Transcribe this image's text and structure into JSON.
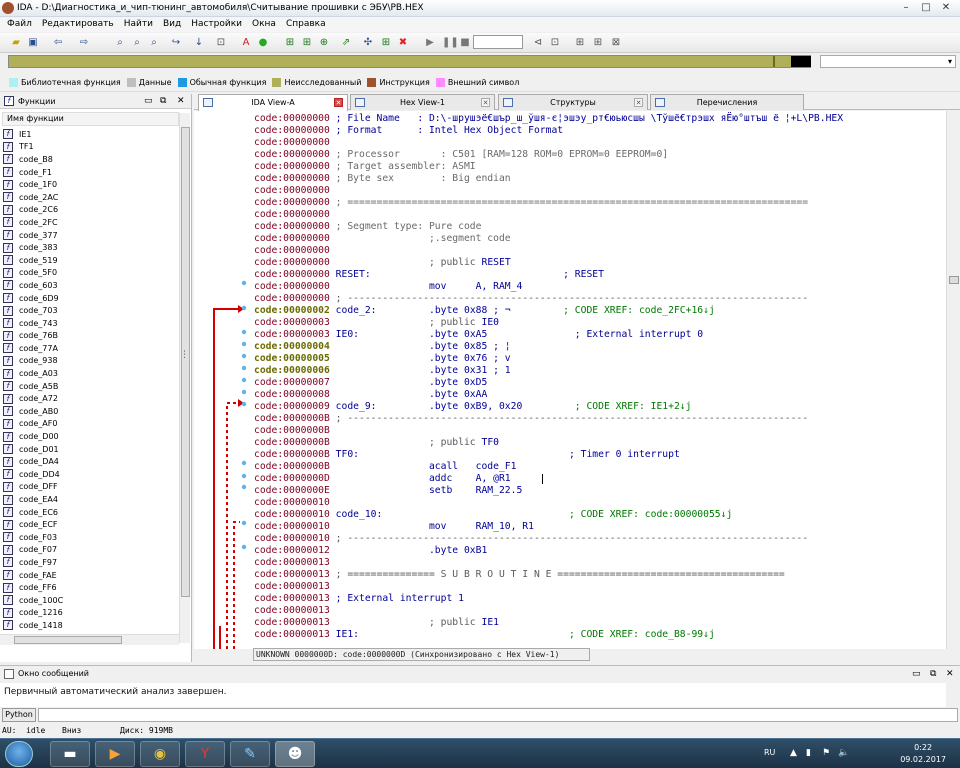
{
  "title": "IDA - D:\\Диагностика_и_чип-тюнинг_автомобиля\\Считывание прошивки с ЭБУ\\PB.HEX",
  "window_buttons": [
    "–",
    "□",
    "✕"
  ],
  "menu": [
    "Файл",
    "Редактировать",
    "Найти",
    "Вид",
    "Настройки",
    "Окна",
    "Справка"
  ],
  "nav_select": "▾",
  "legend": [
    {
      "label": "Библиотечная функция",
      "color": "#aef0f0"
    },
    {
      "label": "Данные",
      "color": "#bfbfbf"
    },
    {
      "label": "Обычная функция",
      "color": "#1e9ae0"
    },
    {
      "label": "Неисследованный",
      "color": "#b0b05a"
    },
    {
      "label": "Инструкция",
      "color": "#a0522d"
    },
    {
      "label": "Внешний символ",
      "color": "#ff8cff"
    }
  ],
  "functions_panel": {
    "title": "Функции",
    "column": "Имя функции",
    "items": [
      "IE1",
      "TF1",
      "code_B8",
      "code_F1",
      "code_1F0",
      "code_2AC",
      "code_2C6",
      "code_2FC",
      "code_377",
      "code_383",
      "code_519",
      "code_5F0",
      "code_603",
      "code_6D9",
      "code_703",
      "code_743",
      "code_76B",
      "code_77A",
      "code_938",
      "code_A03",
      "code_A5B",
      "code_A72",
      "code_AB0",
      "code_AF0",
      "code_D00",
      "code_D01",
      "code_DA4",
      "code_DD4",
      "code_DFF",
      "code_EA4",
      "code_EC6",
      "code_ECF",
      "code_F03",
      "code_F07",
      "code_F97",
      "code_FAE",
      "code_FF6",
      "code_100C",
      "code_1216",
      "code_1418"
    ]
  },
  "tabs": [
    {
      "label": "IDA View-A",
      "active": true
    },
    {
      "label": "Hex View-1",
      "active": false
    },
    {
      "label": "Структуры",
      "active": false
    },
    {
      "label": "Перечисления",
      "active": false
    }
  ],
  "code_lines": [
    {
      "addr": "code:00000000",
      "parts": [
        {
          "t": " ; File Name   : D:\\-шрушэё€шър_ш_ўшя-є¦эшэу_рт€юьюсшы \\Тўшё€трэшх яЁю°штъш ё ¦+L\\PB.HEX",
          "c": "cmt"
        }
      ]
    },
    {
      "addr": "code:00000000",
      "parts": [
        {
          "t": " ; Format      : Intel Hex Object Format",
          "c": "cmt"
        }
      ]
    },
    {
      "addr": "code:00000000",
      "parts": []
    },
    {
      "addr": "code:00000000",
      "parts": [
        {
          "t": " ; Processor       : C501 [RAM=128 ROM=0 EPROM=0 EEPROM=0]",
          "c": "meta"
        }
      ]
    },
    {
      "addr": "code:00000000",
      "parts": [
        {
          "t": " ; Target assembler: ASMI",
          "c": "meta"
        }
      ]
    },
    {
      "addr": "code:00000000",
      "parts": [
        {
          "t": " ; Byte sex        : Big endian",
          "c": "meta"
        }
      ]
    },
    {
      "addr": "code:00000000",
      "parts": []
    },
    {
      "addr": "code:00000000",
      "rule": true,
      "parts": [
        {
          "t": " ; ===============================================================================",
          "c": "meta"
        }
      ]
    },
    {
      "addr": "code:00000000",
      "parts": []
    },
    {
      "addr": "code:00000000",
      "parts": [
        {
          "t": " ; Segment type: Pure code",
          "c": "meta"
        }
      ]
    },
    {
      "addr": "code:00000000",
      "parts": [
        {
          "t": "                 ;.segment code",
          "c": "meta"
        }
      ]
    },
    {
      "addr": "code:00000000",
      "parts": []
    },
    {
      "addr": "code:00000000",
      "parts": [
        {
          "t": "                 ; public ",
          "c": "gray"
        },
        {
          "t": "RESET",
          "c": "lbl"
        }
      ]
    },
    {
      "addr": "code:00000000",
      "parts": [
        {
          "t": " RESET:",
          "c": "lbl"
        },
        {
          "t": "                                 ; RESET",
          "c": "cmt"
        }
      ]
    },
    {
      "addr": "code:00000000",
      "parts": [
        {
          "t": "                 mov     A, RAM_4",
          "c": "ins"
        }
      ]
    },
    {
      "addr": "code:00000000",
      "rule": true,
      "parts": [
        {
          "t": " ; -------------------------------------------------------------------------------",
          "c": "gray"
        }
      ]
    },
    {
      "addr": "code:00000002",
      "hl": true,
      "parts": [
        {
          "t": " code_2:",
          "c": "lbl"
        },
        {
          "t": "         .byte 0x88 ; ¬",
          "c": "ins"
        },
        {
          "t": "         ; CODE XREF: code_2FC+16↓j",
          "c": "xref"
        }
      ]
    },
    {
      "addr": "code:00000003",
      "parts": [
        {
          "t": "                 ; public ",
          "c": "gray"
        },
        {
          "t": "IE0",
          "c": "lbl"
        }
      ]
    },
    {
      "addr": "code:00000003",
      "parts": [
        {
          "t": " IE0:",
          "c": "lbl"
        },
        {
          "t": "            .byte 0xA5",
          "c": "ins"
        },
        {
          "t": "               ; External interrupt 0",
          "c": "cmt"
        }
      ]
    },
    {
      "addr": "code:00000004",
      "hl": true,
      "parts": [
        {
          "t": "                 .byte 0x85 ; ¦",
          "c": "ins"
        }
      ]
    },
    {
      "addr": "code:00000005",
      "hl": true,
      "parts": [
        {
          "t": "                 .byte 0x76 ; v",
          "c": "ins"
        }
      ]
    },
    {
      "addr": "code:00000006",
      "hl": true,
      "parts": [
        {
          "t": "                 .byte 0x31 ; 1",
          "c": "ins"
        }
      ]
    },
    {
      "addr": "code:00000007",
      "parts": [
        {
          "t": "                 .byte 0xD5",
          "c": "ins"
        }
      ]
    },
    {
      "addr": "code:00000008",
      "parts": [
        {
          "t": "                 .byte 0xAA",
          "c": "ins"
        }
      ]
    },
    {
      "addr": "code:00000009",
      "parts": [
        {
          "t": " code_9:",
          "c": "lbl"
        },
        {
          "t": "         .byte 0xB9, 0x20",
          "c": "ins"
        },
        {
          "t": "         ; CODE XREF: IE1+2↓j",
          "c": "xref"
        }
      ]
    },
    {
      "addr": "code:0000000B",
      "rule": true,
      "parts": [
        {
          "t": " ; -------------------------------------------------------------------------------",
          "c": "gray"
        }
      ]
    },
    {
      "addr": "code:0000000B",
      "parts": []
    },
    {
      "addr": "code:0000000B",
      "parts": [
        {
          "t": "                 ; public ",
          "c": "gray"
        },
        {
          "t": "TF0",
          "c": "lbl"
        }
      ]
    },
    {
      "addr": "code:0000000B",
      "parts": [
        {
          "t": " TF0:",
          "c": "lbl"
        },
        {
          "t": "                                    ; Timer 0 interrupt",
          "c": "cmt"
        }
      ]
    },
    {
      "addr": "code:0000000B",
      "parts": [
        {
          "t": "                 acall   code_F1",
          "c": "ins"
        }
      ]
    },
    {
      "addr": "code:0000000D",
      "sel": true,
      "parts": [
        {
          "t": "                 addc    A, @R1",
          "c": "ins"
        }
      ]
    },
    {
      "addr": "code:0000000E",
      "parts": [
        {
          "t": "                 setb    RAM_22.5",
          "c": "ins"
        }
      ]
    },
    {
      "addr": "code:00000010",
      "parts": []
    },
    {
      "addr": "code:00000010",
      "parts": [
        {
          "t": " code_10:",
          "c": "lbl"
        },
        {
          "t": "                                ; CODE XREF: code:00000055↓j",
          "c": "xref"
        }
      ]
    },
    {
      "addr": "code:00000010",
      "parts": [
        {
          "t": "                 mov     RAM_10, R1",
          "c": "ins"
        }
      ]
    },
    {
      "addr": "code:00000010",
      "rule": true,
      "parts": [
        {
          "t": " ; -------------------------------------------------------------------------------",
          "c": "gray"
        }
      ]
    },
    {
      "addr": "code:00000012",
      "parts": [
        {
          "t": "                 .byte 0xB1",
          "c": "ins"
        }
      ]
    },
    {
      "addr": "code:00000013",
      "parts": []
    },
    {
      "addr": "code:00000013",
      "parts": [
        {
          "t": " ; =============== S U B R O U T I N E =======================================",
          "c": "gray"
        }
      ]
    },
    {
      "addr": "code:00000013",
      "parts": []
    },
    {
      "addr": "code:00000013",
      "parts": [
        {
          "t": " ; External interrupt 1",
          "c": "cmt"
        }
      ]
    },
    {
      "addr": "code:00000013",
      "parts": []
    },
    {
      "addr": "code:00000013",
      "parts": [
        {
          "t": "                 ; public ",
          "c": "gray"
        },
        {
          "t": "IE1",
          "c": "lbl"
        }
      ]
    },
    {
      "addr": "code:00000013",
      "parts": [
        {
          "t": " IE1:",
          "c": "lbl"
        },
        {
          "t": "                                    ; CODE XREF: code_B8-99↓j",
          "c": "xref"
        }
      ]
    }
  ],
  "code_status": "UNKNOWN 0000000D: code:0000000D (Синхронизировано с Hex View-1)",
  "output_panel": {
    "title": "Окно сообщений",
    "message": "Первичный автоматический анализ завершен.",
    "python_button": "Python"
  },
  "status_bar": {
    "au": "AU:  idle",
    "direction": "Вниз",
    "disk": "Диск: 919MB"
  },
  "taskbar": {
    "lang": "RU",
    "time": "0:22",
    "date": "09.02.2017"
  }
}
